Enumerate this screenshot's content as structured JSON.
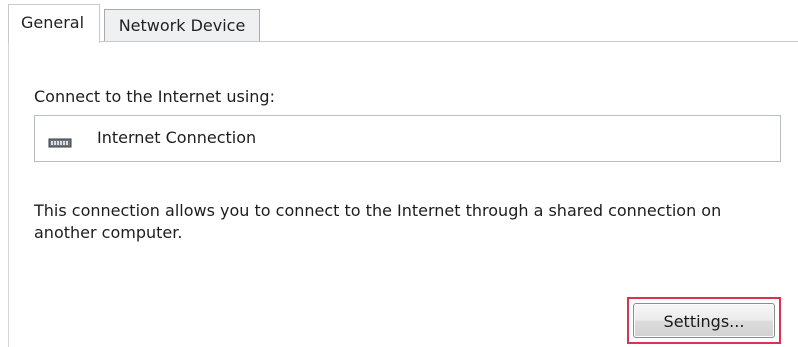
{
  "tabs": {
    "general": "General",
    "network_device": "Network Device"
  },
  "general": {
    "connect_label": "Connect to the Internet using:",
    "connection": {
      "name": "Internet Connection",
      "icon": "network-adapter-icon"
    },
    "description": "This connection allows you to connect to the Internet through a shared connection on another computer.",
    "settings_button": "Settings..."
  },
  "colors": {
    "highlight": "#d8344f",
    "tab_inactive": "#eef0f2"
  }
}
